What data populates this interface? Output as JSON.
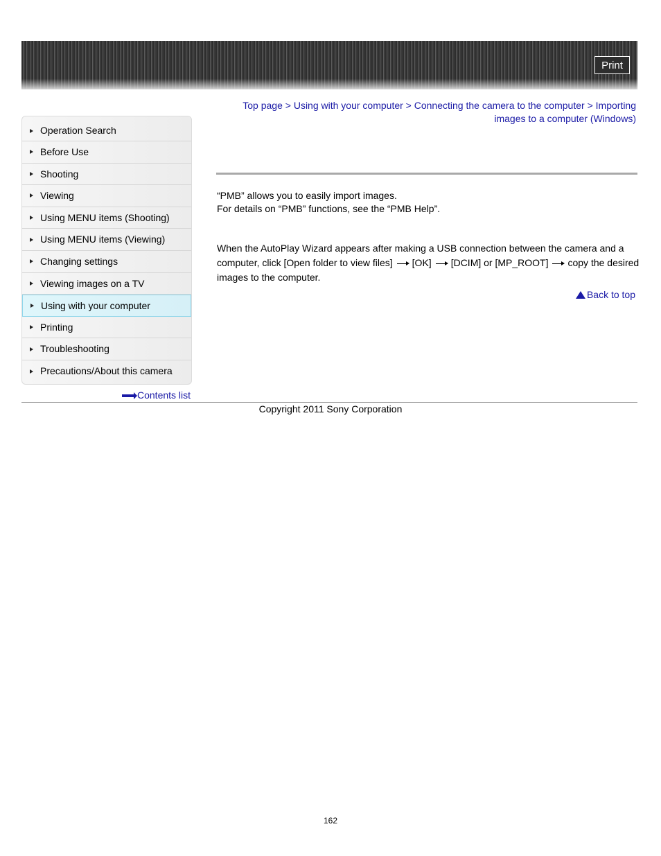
{
  "header": {
    "print_label": "Print"
  },
  "breadcrumb": {
    "items": [
      "Top page",
      "Using with your computer",
      "Connecting the camera to the computer",
      "Importing images to a computer (Windows)"
    ],
    "separator": ">"
  },
  "sidebar": {
    "items": [
      {
        "label": "Operation Search"
      },
      {
        "label": "Before Use"
      },
      {
        "label": "Shooting"
      },
      {
        "label": "Viewing"
      },
      {
        "label": "Using MENU items (Shooting)"
      },
      {
        "label": "Using MENU items (Viewing)"
      },
      {
        "label": "Changing settings"
      },
      {
        "label": "Viewing images on a TV"
      },
      {
        "label": "Using with your computer",
        "active": true
      },
      {
        "label": "Printing"
      },
      {
        "label": "Troubleshooting"
      },
      {
        "label": "Precautions/About this camera"
      }
    ],
    "contents_list_label": "Contents list"
  },
  "main": {
    "intro_line1": "“PMB” allows you to easily import images.",
    "intro_line2": "For details on “PMB” functions, see the “PMB Help”.",
    "steps": {
      "part1": "When the AutoPlay Wizard appears after making a USB connection between the camera and a computer, click [Open folder to view files]",
      "part2": "[OK]",
      "part3": "[DCIM] or [MP_ROOT]",
      "part4": "copy the desired images to the computer."
    },
    "back_to_top_label": "Back to top"
  },
  "footer": {
    "copyright": "Copyright 2011 Sony Corporation",
    "page_number": "162"
  }
}
